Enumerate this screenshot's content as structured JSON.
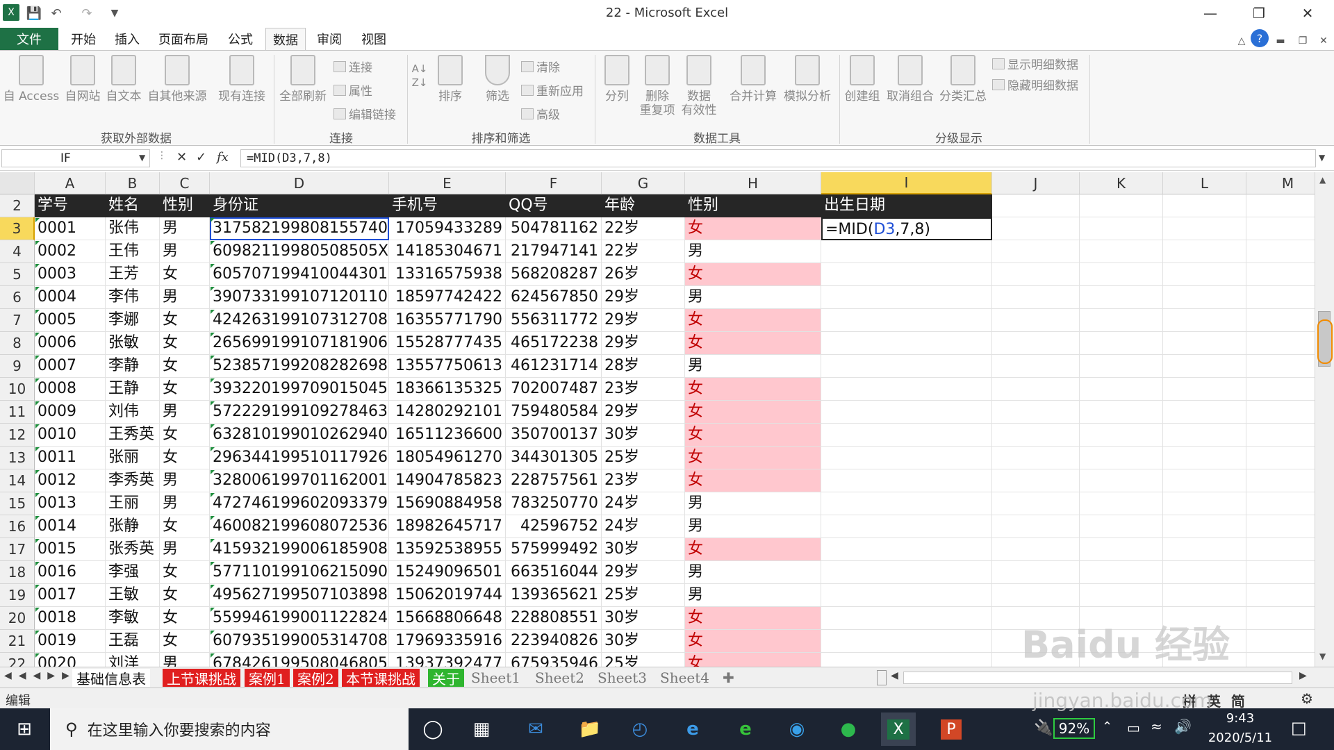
{
  "window": {
    "title": "22 - Microsoft Excel"
  },
  "ribbon_tabs": [
    "文件",
    "开始",
    "插入",
    "页面布局",
    "公式",
    "数据",
    "审阅",
    "视图"
  ],
  "ribbon": {
    "get_external": {
      "group": "获取外部数据",
      "buttons": [
        "自 Access",
        "自网站",
        "自文本",
        "自其他来源",
        "现有连接"
      ]
    },
    "connections": {
      "group": "连接",
      "refresh": "全部刷新",
      "items": [
        "连接",
        "属性",
        "编辑链接"
      ]
    },
    "sort_filter": {
      "group": "排序和筛选",
      "sort": "排序",
      "filter": "筛选",
      "items": [
        "清除",
        "重新应用",
        "高级"
      ]
    },
    "data_tools": {
      "group": "数据工具",
      "buttons": [
        "分列",
        "删除\n重复项",
        "数据\n有效性",
        "合并计算",
        "模拟分析"
      ]
    },
    "outline": {
      "group": "分级显示",
      "buttons": [
        "创建组",
        "取消组合",
        "分类汇总"
      ],
      "items": [
        "显示明细数据",
        "隐藏明细数据"
      ]
    }
  },
  "formula_bar": {
    "name_box": "IF",
    "formula": "=MID(D3,7,8)"
  },
  "columns": [
    "A",
    "B",
    "C",
    "D",
    "E",
    "F",
    "G",
    "H",
    "I",
    "J",
    "K",
    "L",
    "M"
  ],
  "header_row": {
    "row": "2",
    "cells": [
      "学号",
      "姓名",
      "性别",
      "身份证",
      "手机号",
      "QQ号",
      "年龄",
      "性别",
      "出生日期"
    ]
  },
  "rows": [
    {
      "row": "3",
      "cells": [
        "0001",
        "张伟",
        "男",
        "317582199808155740",
        "17059433289",
        "504781162",
        "22岁",
        "女"
      ],
      "pink": true
    },
    {
      "row": "4",
      "cells": [
        "0002",
        "王伟",
        "男",
        "60982119980508505X",
        "14185304671",
        "217947141",
        "22岁",
        "男"
      ],
      "pink": false
    },
    {
      "row": "5",
      "cells": [
        "0003",
        "王芳",
        "女",
        "605707199410044301",
        "13316575938",
        "568208287",
        "26岁",
        "女"
      ],
      "pink": true
    },
    {
      "row": "6",
      "cells": [
        "0004",
        "李伟",
        "男",
        "390733199107120110",
        "18597742422",
        "624567850",
        "29岁",
        "男"
      ],
      "pink": false
    },
    {
      "row": "7",
      "cells": [
        "0005",
        "李娜",
        "女",
        "424263199107312708",
        "16355771790",
        "556311772",
        "29岁",
        "女"
      ],
      "pink": true
    },
    {
      "row": "8",
      "cells": [
        "0006",
        "张敏",
        "女",
        "265699199107181906",
        "15528777435",
        "465172238",
        "29岁",
        "女"
      ],
      "pink": true
    },
    {
      "row": "9",
      "cells": [
        "0007",
        "李静",
        "女",
        "523857199208282698",
        "13557750613",
        "461231714",
        "28岁",
        "男"
      ],
      "pink": false
    },
    {
      "row": "10",
      "cells": [
        "0008",
        "王静",
        "女",
        "393220199709015045",
        "18366135325",
        "702007487",
        "23岁",
        "女"
      ],
      "pink": true
    },
    {
      "row": "11",
      "cells": [
        "0009",
        "刘伟",
        "男",
        "572229199109278463",
        "14280292101",
        "759480584",
        "29岁",
        "女"
      ],
      "pink": true
    },
    {
      "row": "12",
      "cells": [
        "0010",
        "王秀英",
        "女",
        "632810199010262940",
        "16511236600",
        "350700137",
        "30岁",
        "女"
      ],
      "pink": true
    },
    {
      "row": "13",
      "cells": [
        "0011",
        "张丽",
        "女",
        "296344199510117926",
        "18054961270",
        "344301305",
        "25岁",
        "女"
      ],
      "pink": true
    },
    {
      "row": "14",
      "cells": [
        "0012",
        "李秀英",
        "男",
        "328006199701162001",
        "14904785823",
        "228757561",
        "23岁",
        "女"
      ],
      "pink": true
    },
    {
      "row": "15",
      "cells": [
        "0013",
        "王丽",
        "男",
        "472746199602093379",
        "15690884958",
        "783250770",
        "24岁",
        "男"
      ],
      "pink": false
    },
    {
      "row": "16",
      "cells": [
        "0014",
        "张静",
        "女",
        "460082199608072536",
        "18982645717",
        "42596752",
        "24岁",
        "男"
      ],
      "pink": false
    },
    {
      "row": "17",
      "cells": [
        "0015",
        "张秀英",
        "男",
        "415932199006185908",
        "13592538955",
        "575999492",
        "30岁",
        "女"
      ],
      "pink": true
    },
    {
      "row": "18",
      "cells": [
        "0016",
        "李强",
        "女",
        "577110199106215090",
        "15249096501",
        "663516044",
        "29岁",
        "男"
      ],
      "pink": false
    },
    {
      "row": "19",
      "cells": [
        "0017",
        "王敏",
        "女",
        "495627199507103898",
        "15062019744",
        "139365621",
        "25岁",
        "男"
      ],
      "pink": false
    },
    {
      "row": "20",
      "cells": [
        "0018",
        "李敏",
        "女",
        "559946199001122824",
        "15668806648",
        "228808551",
        "30岁",
        "女"
      ],
      "pink": true
    },
    {
      "row": "21",
      "cells": [
        "0019",
        "王磊",
        "女",
        "607935199005314708",
        "17969335916",
        "223940826",
        "30岁",
        "女"
      ],
      "pink": true
    },
    {
      "row": "22",
      "cells": [
        "0020",
        "刘洋",
        "男",
        "678426199508046805",
        "13937392477",
        "675935946",
        "25岁",
        "女"
      ],
      "pink": true
    }
  ],
  "editing_cell": {
    "prefix": "=MID(",
    "ref": "D3",
    "suffix": ",7,8)"
  },
  "sheet_tabs": [
    {
      "label": "基础信息表",
      "style": "cur"
    },
    {
      "label": "上节课挑战",
      "style": "red"
    },
    {
      "label": "案例1",
      "style": "red"
    },
    {
      "label": "案例2",
      "style": "red"
    },
    {
      "label": "本节课挑战",
      "style": "red"
    },
    {
      "label": "关于",
      "style": "grn"
    },
    {
      "label": "Sheet1",
      "style": "plain"
    },
    {
      "label": "Sheet2",
      "style": "plain"
    },
    {
      "label": "Sheet3",
      "style": "plain"
    },
    {
      "label": "Sheet4",
      "style": "plain"
    }
  ],
  "status": {
    "mode": "编辑",
    "ime": "拼 英 简"
  },
  "taskbar": {
    "search_placeholder": "在这里输入你要搜索的内容",
    "battery": "92%",
    "time": "9:43",
    "date": "2020/5/11"
  },
  "watermark": {
    "text": "Baidu 经验",
    "url": "jingyan.baidu.com"
  },
  "colors": {
    "excel_green": "#1e7145",
    "header_dark": "#262626",
    "pink_fill": "#ffc7ce",
    "pink_text": "#c00000",
    "selected_header": "#f8d95c",
    "tab_red": "#e01f1f",
    "tab_green": "#2fb52f",
    "ref_blue": "#1f4fd6"
  }
}
